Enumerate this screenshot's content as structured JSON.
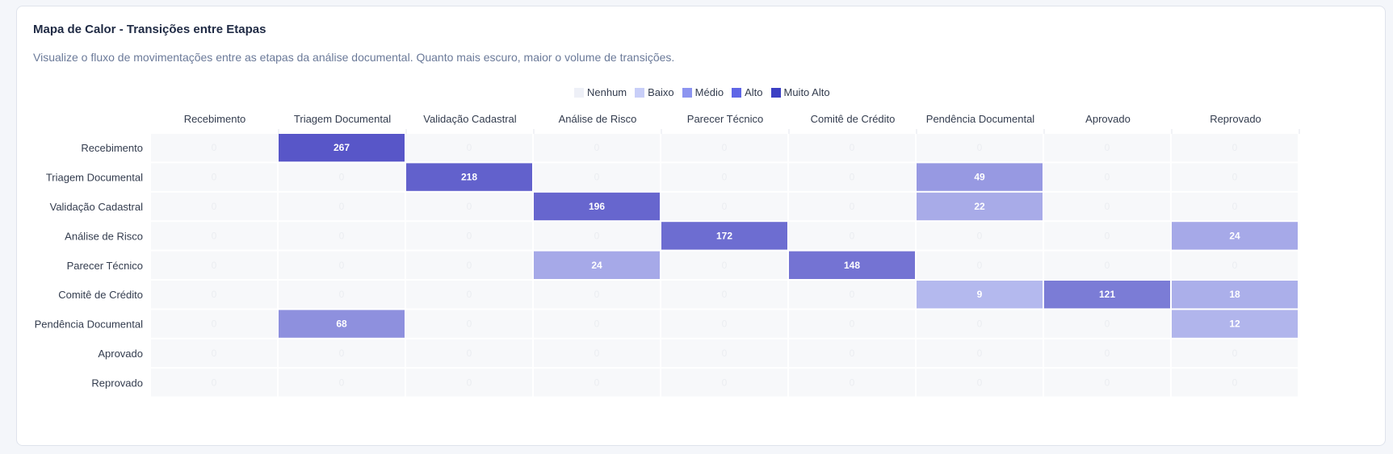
{
  "card": {
    "title": "Mapa de Calor - Transições entre Etapas",
    "subtitle": "Visualize o fluxo de movimentações entre as etapas da análise documental. Quanto mais escuro, maior o volume de transições."
  },
  "legend": [
    {
      "label": "Nenhum",
      "color": "#eef0f7"
    },
    {
      "label": "Baixo",
      "color": "#c8cef8"
    },
    {
      "label": "Médio",
      "color": "#8c94f0"
    },
    {
      "label": "Alto",
      "color": "#5f66e6"
    },
    {
      "label": "Muito Alto",
      "color": "#3b3fc4"
    }
  ],
  "chart_data": {
    "type": "heatmap",
    "title": "Mapa de Calor - Transições entre Etapas",
    "x_categories": [
      "Recebimento",
      "Triagem Documental",
      "Validação Cadastral",
      "Análise de Risco",
      "Parecer Técnico",
      "Comitê de Crédito",
      "Pendência Documental",
      "Aprovado",
      "Reprovado"
    ],
    "y_categories": [
      "Recebimento",
      "Triagem Documental",
      "Validação Cadastral",
      "Análise de Risco",
      "Parecer Técnico",
      "Comitê de Crédito",
      "Pendência Documental",
      "Aprovado",
      "Reprovado"
    ],
    "values": [
      [
        0,
        267,
        0,
        0,
        0,
        0,
        0,
        0,
        0
      ],
      [
        0,
        0,
        218,
        0,
        0,
        0,
        49,
        0,
        0
      ],
      [
        0,
        0,
        0,
        196,
        0,
        0,
        22,
        0,
        0
      ],
      [
        0,
        0,
        0,
        0,
        172,
        0,
        0,
        0,
        24
      ],
      [
        0,
        0,
        0,
        24,
        0,
        148,
        0,
        0,
        0
      ],
      [
        0,
        0,
        0,
        0,
        0,
        0,
        9,
        121,
        18
      ],
      [
        0,
        68,
        0,
        0,
        0,
        0,
        0,
        0,
        12
      ],
      [
        0,
        0,
        0,
        0,
        0,
        0,
        0,
        0,
        0
      ],
      [
        0,
        0,
        0,
        0,
        0,
        0,
        0,
        0,
        0
      ]
    ],
    "max": 267,
    "legend_position": "top-center"
  }
}
